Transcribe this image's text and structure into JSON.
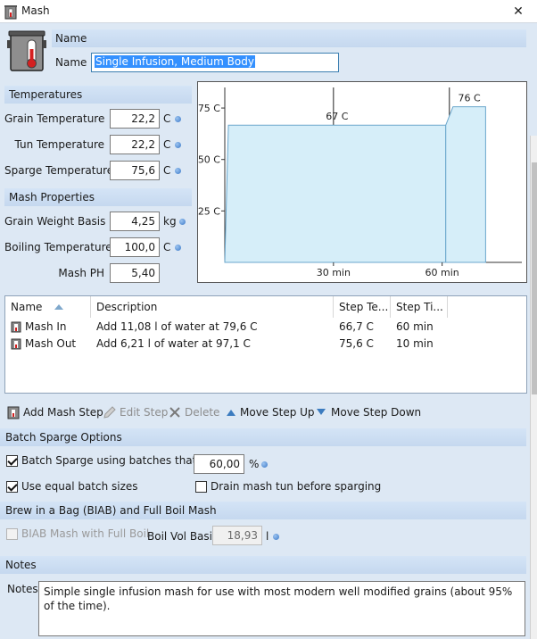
{
  "window": {
    "title": "Mash",
    "close_glyph": "✕"
  },
  "name_section": {
    "heading": "Name",
    "label": "Name",
    "value": "Single Infusion, Medium Body"
  },
  "temperatures": {
    "heading": "Temperatures",
    "grain_label": "Grain Temperature",
    "grain_value": "22,2",
    "grain_unit": "C",
    "tun_label": "Tun Temperature",
    "tun_value": "22,2",
    "tun_unit": "C",
    "sparge_label": "Sparge Temperature",
    "sparge_value": "75,6",
    "sparge_unit": "C"
  },
  "mash_properties": {
    "heading": "Mash Properties",
    "weight_label": "Grain Weight Basis",
    "weight_value": "4,25",
    "weight_unit": "kg",
    "boil_label": "Boiling Temperature",
    "boil_value": "100,0",
    "boil_unit": "C",
    "ph_label": "Mash PH",
    "ph_value": "5,40"
  },
  "chart_data": {
    "type": "area",
    "y_ticks": [
      25,
      50,
      75
    ],
    "y_tick_labels": [
      "25 C",
      "50 C",
      "75 C"
    ],
    "x_ticks": [
      30,
      60
    ],
    "x_tick_labels": [
      "30 min",
      "60 min"
    ],
    "xlim": [
      0,
      82
    ],
    "ylim": [
      0,
      85
    ],
    "steps": [
      {
        "label": "67 C",
        "start": 1,
        "end": 61,
        "temp": 66.7
      },
      {
        "label": "76 C",
        "start": 63,
        "end": 72,
        "temp": 75.6
      }
    ],
    "markers": [
      30,
      62
    ],
    "fill_color": "#d6eef9",
    "line_color": "#6aa6cc"
  },
  "table": {
    "columns": [
      "Name",
      "Description",
      "Step Te...",
      "Step Ti..."
    ],
    "rows": [
      {
        "name": "Mash In",
        "description": "Add 11,08 l of water at 79,6 C",
        "temp": "66,7 C",
        "time": "60 min"
      },
      {
        "name": "Mash Out",
        "description": "Add 6,21 l of water at 97,1 C",
        "temp": "75,6 C",
        "time": "10 min"
      }
    ]
  },
  "toolbar": {
    "add": "Add Mash Step",
    "edit": "Edit Step",
    "delete": "Delete",
    "up": "Move Step Up",
    "down": "Move Step Down"
  },
  "batch_sparge": {
    "heading": "Batch Sparge Options",
    "fill_label": "Batch Sparge using batches that fill",
    "fill_value": "60,00",
    "fill_unit": "%",
    "equal_label": "Use equal batch sizes",
    "drain_label": "Drain mash tun before sparging"
  },
  "biab": {
    "heading": "Brew in a Bag (BIAB) and Full Boil Mash",
    "check_label": "BIAB Mash with Full Boil",
    "vol_label": "Boil Vol Basis",
    "vol_value": "18,93",
    "vol_unit": "l"
  },
  "notes": {
    "heading": "Notes",
    "label": "Notes",
    "text": "Simple single infusion mash for use with most modern well modified grains (about 95% of the time)."
  },
  "colors": {
    "accent_blue": "#3390ff",
    "band": "#c5d8ef",
    "background": "#dde8f4"
  }
}
